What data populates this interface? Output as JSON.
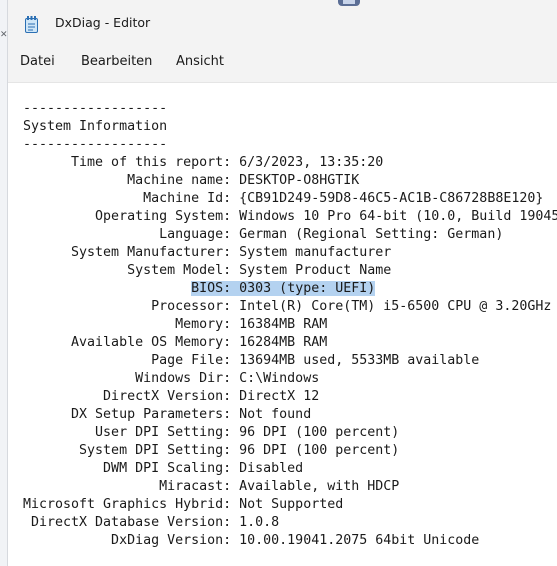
{
  "window": {
    "title": "DxDiag - Editor",
    "icon": "notepad-icon"
  },
  "menu": {
    "items": [
      "Datei",
      "Bearbeiten",
      "Ansicht"
    ]
  },
  "background": {
    "icon": "close-icon"
  },
  "document": {
    "lines": [
      "------------------",
      "System Information",
      "------------------",
      "      Time of this report: 6/3/2023, 13:35:20",
      "             Machine name: DESKTOP-O8HGTIK",
      "               Machine Id: {CB91D249-59D8-46C5-AC1B-C86728B8E120}",
      "         Operating System: Windows 10 Pro 64-bit (10.0, Build 19045",
      "                 Language: German (Regional Setting: German)",
      "      System Manufacturer: System manufacturer",
      "             System Model: System Product Name",
      "                     BIOS: 0303 (type: UEFI)",
      "                Processor: Intel(R) Core(TM) i5-6500 CPU @ 3.20GHz",
      "                   Memory: 16384MB RAM",
      "      Available OS Memory: 16284MB RAM",
      "                Page File: 13694MB used, 5533MB available",
      "              Windows Dir: C:\\Windows",
      "          DirectX Version: DirectX 12",
      "      DX Setup Parameters: Not found",
      "         User DPI Setting: 96 DPI (100 percent)",
      "       System DPI Setting: 96 DPI (100 percent)",
      "          DWM DPI Scaling: Disabled",
      "                 Miracast: Available, with HDCP",
      "Microsoft Graphics Hybrid: Not Supported",
      " DirectX Database Version: 1.0.8",
      "           DxDiag Version: 10.00.19041.2075 64bit Unicode"
    ],
    "selection": {
      "line": 10,
      "text": "BIOS: 0303 (type: UEFI)"
    }
  }
}
